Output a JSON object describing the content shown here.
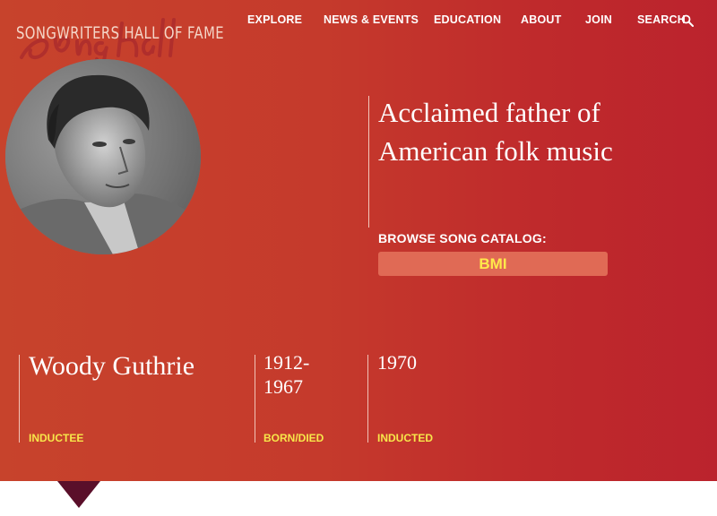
{
  "site": {
    "logo_text": "SONGWRITERS HALL OF FAME",
    "logo_script": "SongHall"
  },
  "nav": {
    "items": [
      {
        "label": "EXPLORE"
      },
      {
        "label": "NEWS & EVENTS"
      },
      {
        "label": "EDUCATION"
      },
      {
        "label": "ABOUT"
      },
      {
        "label": "JOIN"
      },
      {
        "label": "SEARCH"
      }
    ]
  },
  "hero": {
    "tagline": "Acclaimed father of American folk music",
    "browse_label": "BROWSE SONG CATALOG:",
    "catalog_button": "BMI"
  },
  "inductee": {
    "name": "Woody Guthrie",
    "name_caption": "INDUCTEE",
    "years_line1": "1912-",
    "years_line2": "1967",
    "years_caption": "BORN/DIED",
    "inducted_year": "1970",
    "inducted_caption": "INDUCTED"
  },
  "colors": {
    "background": "#c53a2c",
    "accent_yellow": "#f7e64a",
    "button": "#e06a55",
    "pointer": "#5a0f2a"
  }
}
